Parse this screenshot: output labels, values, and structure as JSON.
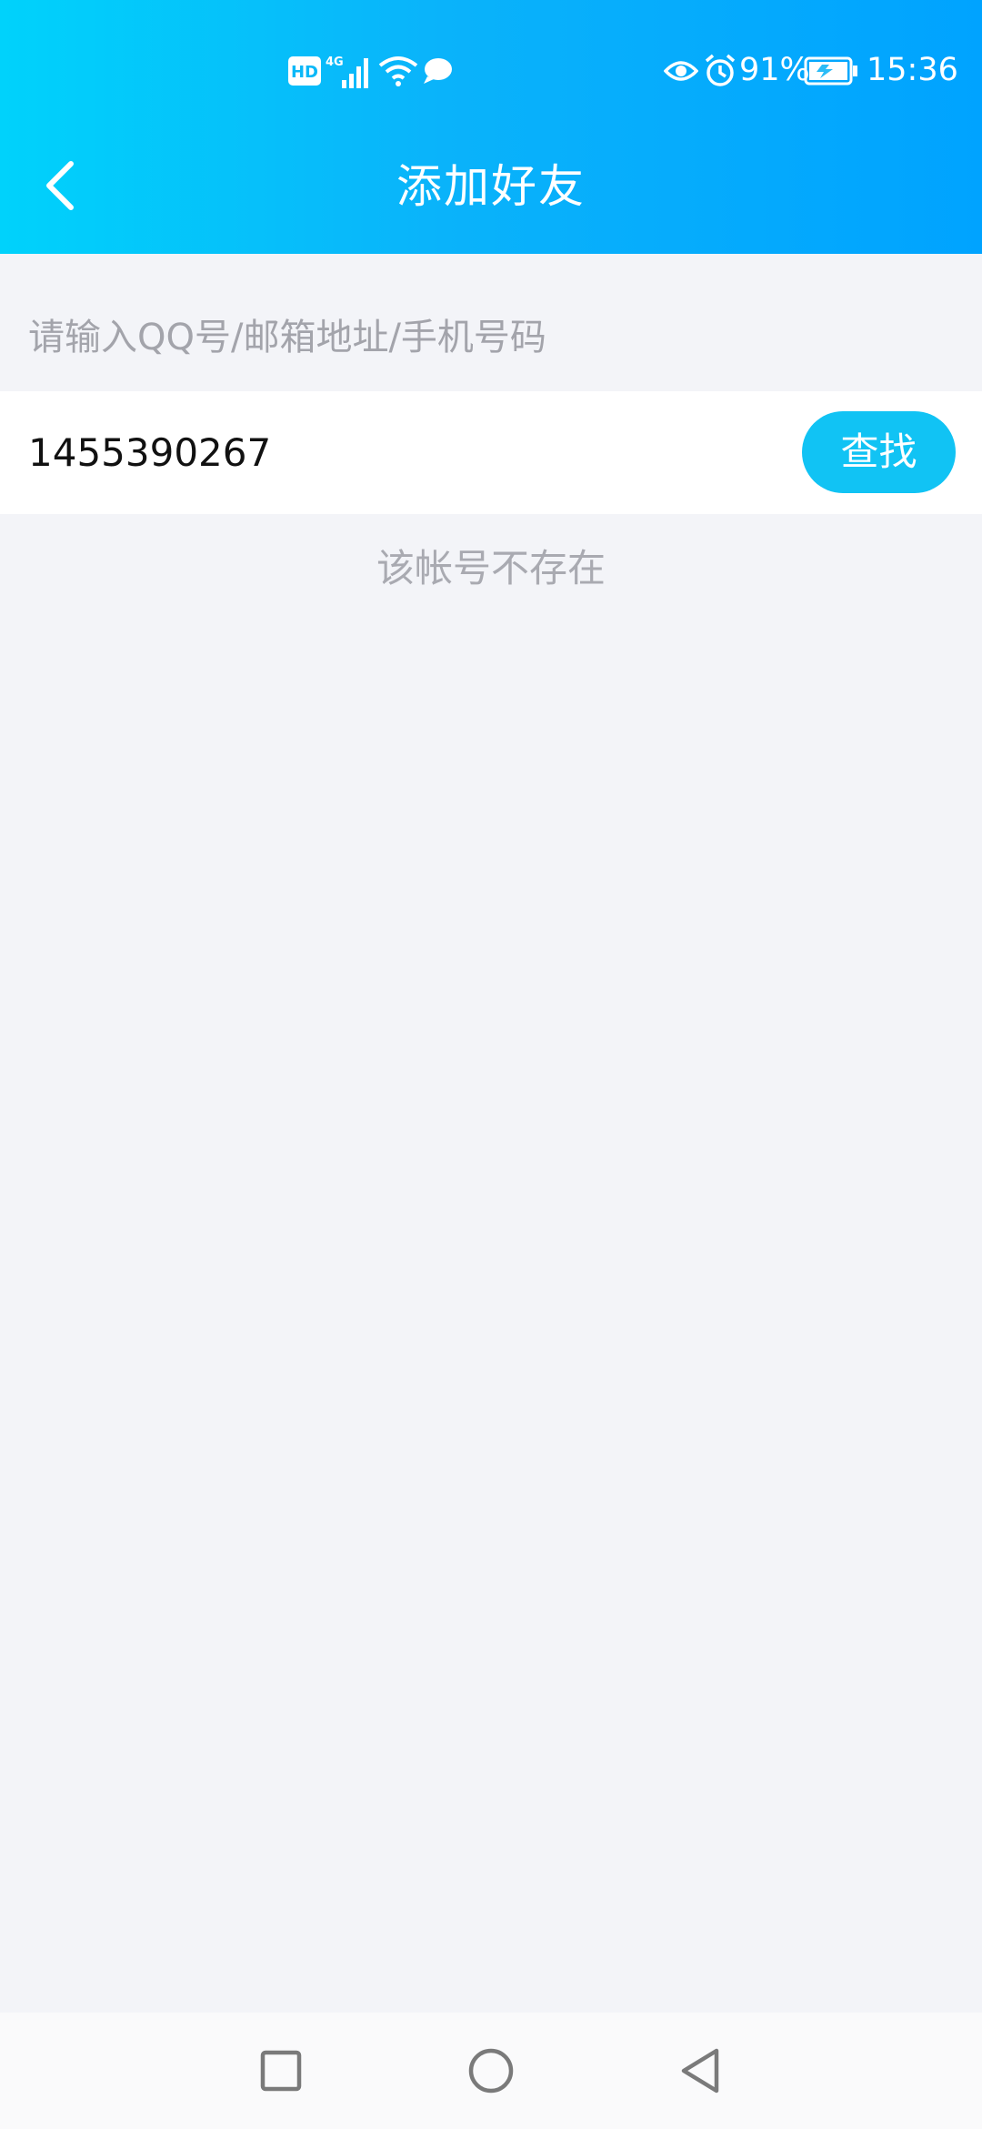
{
  "status_bar": {
    "hd_label": "HD",
    "network_label": "4G",
    "battery_percent": "91%",
    "time": "15:36",
    "icons": [
      "hd-icon",
      "signal-4g-icon",
      "wifi-icon",
      "message-icon",
      "eye-icon",
      "alarm-icon",
      "battery-charging-icon"
    ]
  },
  "header": {
    "title": "添加好友",
    "back_icon": "chevron-left-icon",
    "colors": {
      "gradient_start": "#00d2fb",
      "gradient_end": "#00a3ff"
    }
  },
  "search": {
    "hint": "请输入QQ号/邮箱地址/手机号码",
    "value": "1455390267",
    "button_label": "查找",
    "button_color": "#11c3f4"
  },
  "result": {
    "message": "该帐号不存在"
  },
  "system_nav": {
    "buttons": [
      "recent-apps-icon",
      "home-icon",
      "back-triangle-icon"
    ]
  }
}
